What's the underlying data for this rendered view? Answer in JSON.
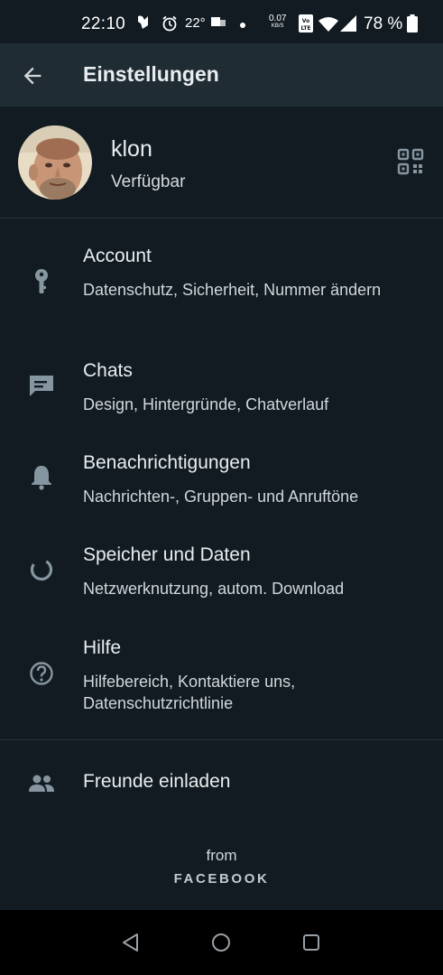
{
  "status_bar": {
    "time": "22:10",
    "temperature": "22°",
    "net_speed": "0.07",
    "net_unit": "KB/S",
    "battery": "78 %"
  },
  "app_bar": {
    "title": "Einstellungen"
  },
  "profile": {
    "name": "klon",
    "status": "Verfügbar"
  },
  "menu": [
    {
      "icon": "key-icon",
      "label": "Account",
      "sub": "Datenschutz, Sicherheit, Nummer ändern"
    },
    {
      "icon": "chat-icon",
      "label": "Chats",
      "sub": "Design, Hintergründe, Chatverlauf"
    },
    {
      "icon": "bell-icon",
      "label": "Benachrichtigungen",
      "sub": "Nachrichten-, Gruppen- und Anruftöne"
    },
    {
      "icon": "data-usage-icon",
      "label": "Speicher und Daten",
      "sub": "Netzwerknutzung, autom. Download"
    },
    {
      "icon": "help-icon",
      "label": "Hilfe",
      "sub": "Hilfebereich, Kontaktiere uns, Datenschutzrichtlinie"
    }
  ],
  "invite": {
    "icon": "people-icon",
    "label": "Freunde einladen"
  },
  "footer": {
    "from": "from",
    "brand": "FACEBOOK"
  },
  "colors": {
    "background": "#121b22",
    "app_bar": "#1f2c34",
    "text": "#e9edef",
    "icon": "#8696a0"
  }
}
